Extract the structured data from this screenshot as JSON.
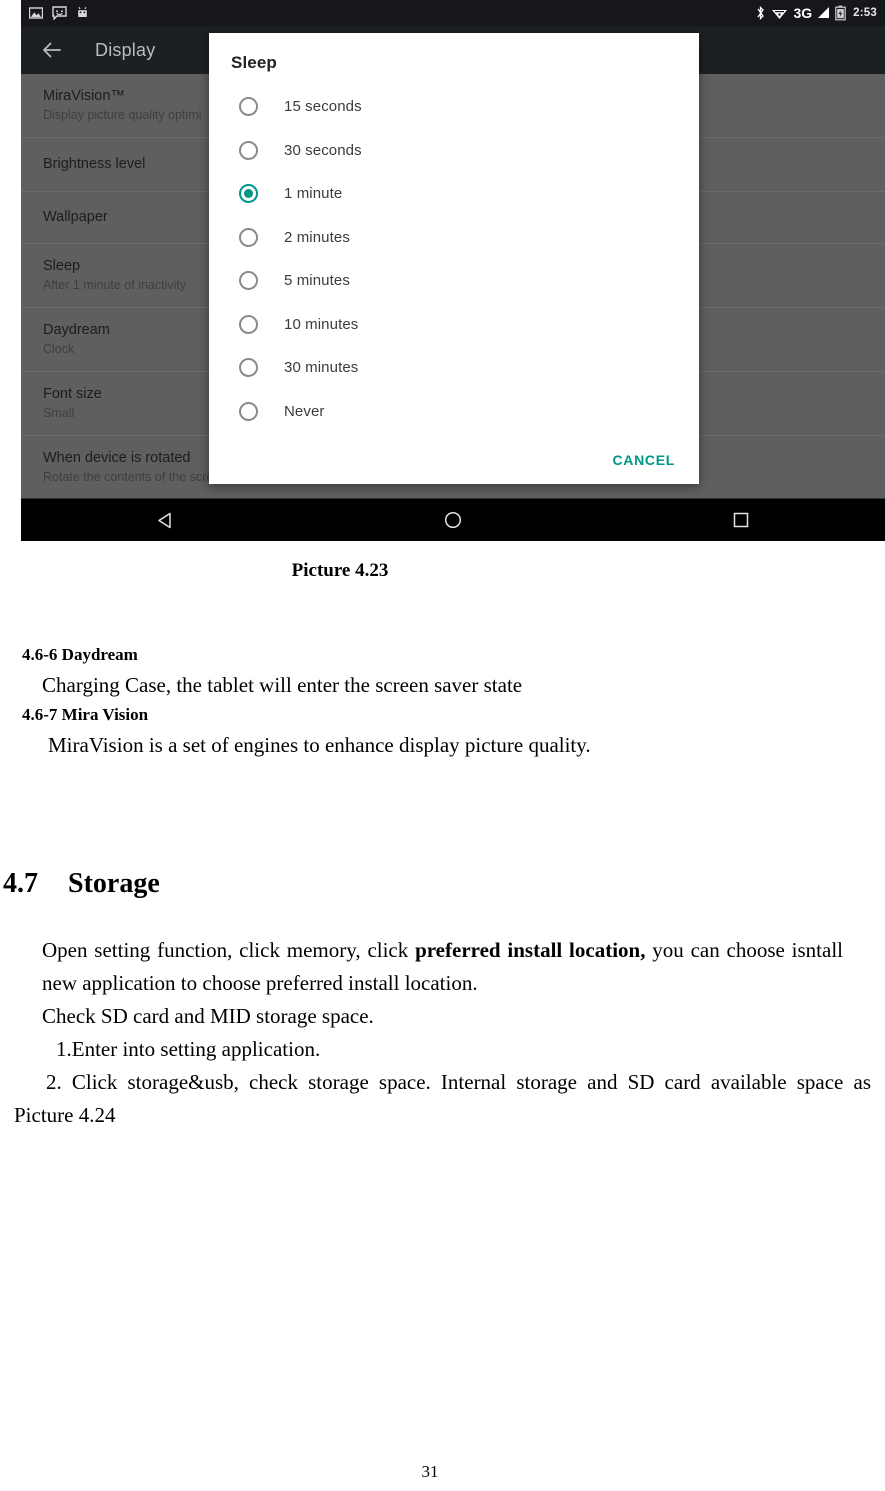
{
  "screenshot": {
    "status_bar": {
      "icons_left": [
        "image-icon",
        "message-icon",
        "android-robot-icon"
      ],
      "icons_right": [
        "bluetooth-icon",
        "wifi-icon",
        "signal-bars-icon",
        "battery-icon"
      ],
      "network_label": "3G",
      "clock": "2:53"
    },
    "app_bar": {
      "back_icon": "back-arrow-icon",
      "title": "Display"
    },
    "settings_rows": [
      {
        "title": "MiraVision™",
        "subtitle": "Display picture quality optimi"
      },
      {
        "title": "Brightness level",
        "subtitle": ""
      },
      {
        "title": "Wallpaper",
        "subtitle": ""
      },
      {
        "title": "Sleep",
        "subtitle": "After 1 minute of inactivity"
      },
      {
        "title": "Daydream",
        "subtitle": "Clock"
      },
      {
        "title": "Font size",
        "subtitle": "Small"
      },
      {
        "title": "When device is rotated",
        "subtitle": "Rotate the contents of the scre"
      }
    ],
    "dialog": {
      "title": "Sleep",
      "options": [
        {
          "label": "15 seconds",
          "selected": false
        },
        {
          "label": "30 seconds",
          "selected": false
        },
        {
          "label": "1 minute",
          "selected": true
        },
        {
          "label": "2 minutes",
          "selected": false
        },
        {
          "label": "5 minutes",
          "selected": false
        },
        {
          "label": "10 minutes",
          "selected": false
        },
        {
          "label": "30 minutes",
          "selected": false
        },
        {
          "label": "Never",
          "selected": false
        }
      ],
      "cancel_label": "CANCEL",
      "accent_color": "#009688"
    },
    "nav_bar": {
      "back_icon": "nav-back-triangle-icon",
      "home_icon": "nav-home-circle-icon",
      "recents_icon": "nav-recents-square-icon"
    }
  },
  "document": {
    "figure_caption": "Picture 4.23",
    "heading_daydream": "4.6-6 Daydream",
    "para_daydream": "Charging Case, the tablet will enter the screen saver state",
    "heading_miravision": "4.6-7 Mira Vision",
    "para_miravision": "MiraVision is a set of engines to enhance display picture quality.",
    "storage_number": "4.7",
    "storage_title": "Storage",
    "para_storage_a1": "Open setting function, click memory, click ",
    "para_storage_bold": "preferred install location,",
    "para_storage_a2": " you can choose isntall new application to choose preferred install location.",
    "para_storage_b": "Check SD card and MID storage space.",
    "para_storage_step1": "1.Enter into setting application.",
    "para_storage_step2": "2. Click storage&usb, check storage space. Internal storage and SD card available space as Picture 4.24",
    "page_number": "31"
  }
}
